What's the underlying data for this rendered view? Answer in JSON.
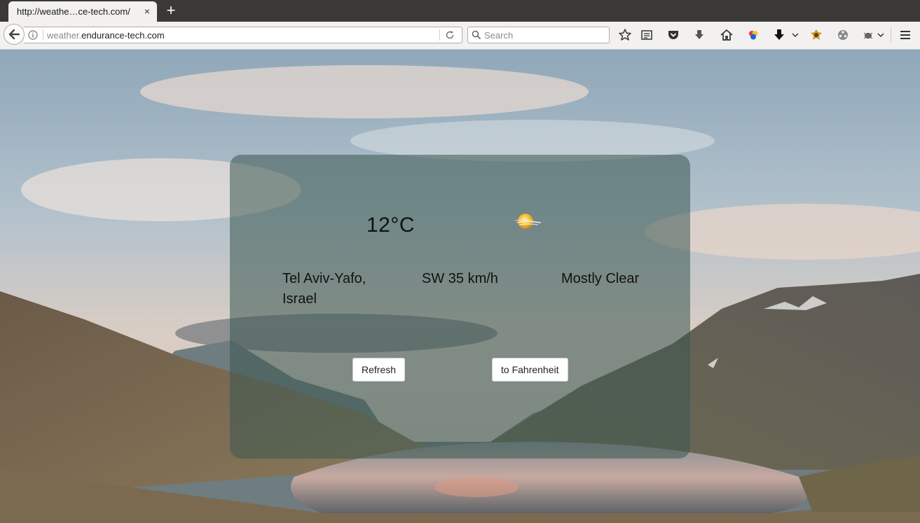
{
  "browser": {
    "tab_title": "http://weathe…ce-tech.com/",
    "tab_close": "×",
    "new_tab": "+",
    "url_dim": "weather.",
    "url_main": "endurance-tech.com",
    "search_placeholder": "Search"
  },
  "weather": {
    "temperature": "12°C",
    "location_line1": "Tel Aviv-Yafo,",
    "location_line2": "Israel",
    "wind": "SW 35 km/h",
    "condition": "Mostly Clear",
    "condition_icon": "sun-with-haze-icon",
    "refresh_label": "Refresh",
    "toggle_unit_label": "to Fahrenheit"
  },
  "colors": {
    "card_overlay": "#3a5850",
    "sky": "#a9b9c4",
    "tabbar": "#3a3935"
  }
}
